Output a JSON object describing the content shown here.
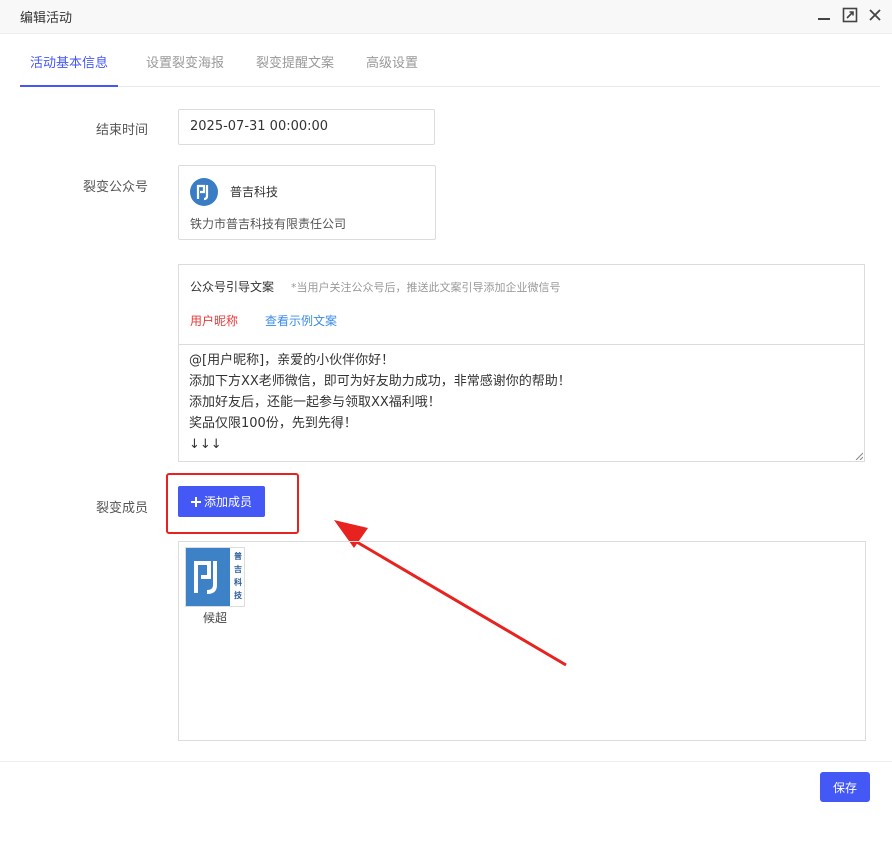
{
  "window": {
    "title": "编辑活动"
  },
  "tabs": [
    {
      "label": "活动基本信息"
    },
    {
      "label": "设置裂变海报"
    },
    {
      "label": "裂变提醒文案"
    },
    {
      "label": "高级设置"
    }
  ],
  "form": {
    "end_time_label": "结束时间",
    "end_time_value": "2025-07-31 00:00:00",
    "account_label": "裂变公众号",
    "account_name": "普吉科技",
    "account_company": "铁力市普吉科技有限责任公司",
    "guide_title": "公众号引导文案",
    "guide_hint": "*当用户关注公众号后，推送此文案引导添加企业微信号",
    "nickname_tag": "用户昵称",
    "example_link": "查看示例文案",
    "guide_text": "@[用户昵称]，亲爱的小伙伴你好！\n添加下方XX老师微信，即可为好友助力成功，非常感谢你的帮助！\n添加好友后，还能一起参与领取XX福利哦！\n奖品仅限100份，先到先得！\n↓↓↓",
    "members_label": "裂变成员",
    "add_member_label": "添加成员",
    "members": [
      {
        "name": "候超",
        "avatar_text": "普吉科技"
      }
    ]
  },
  "footer": {
    "save_label": "保存"
  },
  "colors": {
    "primary": "#4458f5",
    "annotation": "#e8231f",
    "tag_red": "#e6393a",
    "link_blue": "#3c8ce7"
  }
}
